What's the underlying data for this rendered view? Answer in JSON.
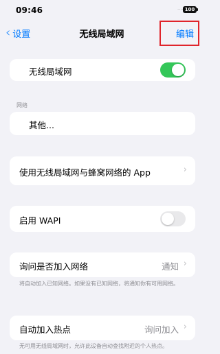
{
  "status_bar": {
    "time": "09:46",
    "signal": "·····",
    "battery": "100"
  },
  "nav": {
    "back_label": "设置",
    "title": "无线局域网",
    "edit_label": "编辑"
  },
  "wifi": {
    "label": "无线局域网",
    "enabled": true
  },
  "networks": {
    "header": "网络",
    "other_label": "其他..."
  },
  "apps_row": {
    "label": "使用无线局域网与蜂窝网络的 App"
  },
  "wapi": {
    "label": "启用 WAPI",
    "enabled": false
  },
  "ask_join": {
    "label": "询问是否加入网络",
    "value": "通知",
    "footnote": "将自动加入已知网络。如果没有已知网络，将通知你有可用网络。"
  },
  "hotspot": {
    "label": "自动加入热点",
    "value": "询问加入",
    "footnote": "无可用无线局域网时，允许此设备自动查找附近的个人热点。"
  },
  "colors": {
    "accent": "#007aff",
    "toggle_on": "#34c759",
    "highlight": "#e0242b",
    "background": "#f2f2f7"
  },
  "icons": {
    "back": "chevron-left-icon",
    "disclosure": "chevron-right-icon"
  }
}
